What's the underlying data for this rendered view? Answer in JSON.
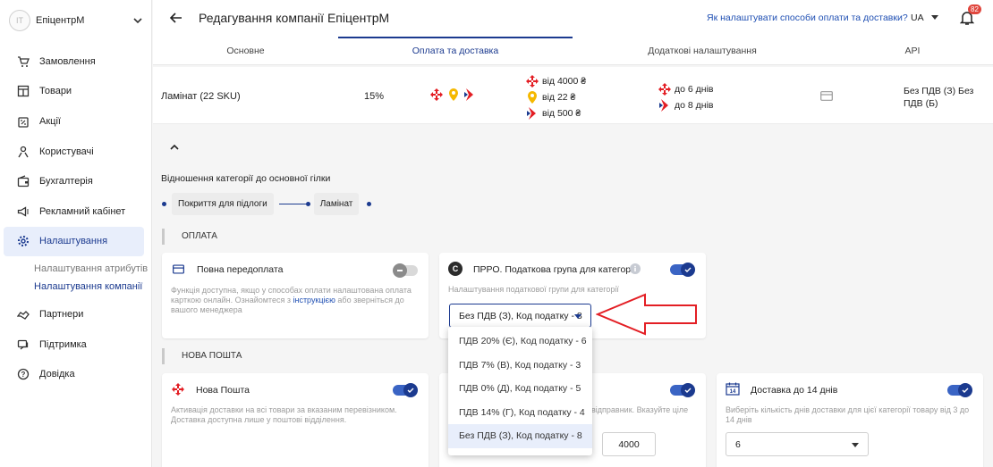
{
  "company": {
    "initials": "IT",
    "name": "ЕпіцентрМ"
  },
  "nav": {
    "items": [
      {
        "label": "Замовлення",
        "icon": "cart-icon"
      },
      {
        "label": "Товари",
        "icon": "catalog-icon"
      },
      {
        "label": "Акції",
        "icon": "promo-icon"
      },
      {
        "label": "Користувачі",
        "icon": "users-icon"
      },
      {
        "label": "Бухгалтерія",
        "icon": "wallet-icon"
      },
      {
        "label": "Рекламний кабінет",
        "icon": "megaphone-icon"
      },
      {
        "label": "Налаштування",
        "icon": "gear-icon"
      }
    ],
    "sub": [
      "Налаштування атрибутів",
      "Налаштування компанії"
    ],
    "items2": [
      {
        "label": "Партнери",
        "icon": "handshake-icon"
      },
      {
        "label": "Підтримка",
        "icon": "support-icon"
      },
      {
        "label": "Довідка",
        "icon": "help-icon"
      }
    ]
  },
  "header": {
    "title": "Редагування компанії ЕпіцентрМ",
    "help_link": "Як налаштувати способи оплати та доставки?",
    "lang": "UA",
    "notifications": "82"
  },
  "tabs": [
    "Основне",
    "Оплата та доставка",
    "Додаткові налаштування",
    "API"
  ],
  "category_row": {
    "name": "Ламінат (22 SKU)",
    "percent": "15%",
    "prices": [
      "від 4000 ₴",
      "від 22 ₴",
      "від 500 ₴"
    ],
    "deliveries": [
      "до 6 днів",
      "до 8 днів"
    ],
    "tax": "Без ПДВ (З) Без ПДВ (Б)"
  },
  "relation_label": "Відношення категорії до основної гілки",
  "breadcrumbs": [
    "Покриття для підлоги",
    "Ламінат"
  ],
  "sections": {
    "payment": "ОПЛАТА",
    "nova_poshta": "НОВА ПОШТА"
  },
  "prepay_card": {
    "title": "Повна передоплата",
    "desc1": "Функція доступна, якщо у способах оплати налаштована оплата карткою онлайн. Ознайомтеся з",
    "link": "інструкцією",
    "desc2": "або зверніться до вашого менеджера"
  },
  "prro_card": {
    "badge": "С",
    "title": "ПРРО. Податкова група для категорії",
    "subtitle": "Налаштування податкової групи для категорії",
    "selected": "Без ПДВ (З), Код податку - 8"
  },
  "dropdown_options": [
    "ПДВ 20% (Є), Код податку - 6",
    "ПДВ 7% (В), Код податку - 3",
    "ПДВ 0% (Д), Код податку - 5",
    "ПДВ 14% (Г), Код податку - 4",
    "Без ПДВ (З), Код податку - 8"
  ],
  "nova_card": {
    "title": "Нова Пошта",
    "desc": "Активація доставки на всі товари за вказаним перевізником. Доставка доступна лише у поштові відділення."
  },
  "middle_card": {
    "desc": "відправник. Вказуйте ціле",
    "value": "4000"
  },
  "delivery14_card": {
    "title": "Доставка до 14 днів",
    "desc": "Виберіть кількість днів доставки для цієї категорії товару від 3 до 14 днів",
    "value": "6",
    "calendar_number": "14"
  },
  "colors": {
    "accent": "#1b3a8f",
    "red": "#e31e24",
    "yellow": "#f5b800",
    "badge": "#e0463d"
  }
}
